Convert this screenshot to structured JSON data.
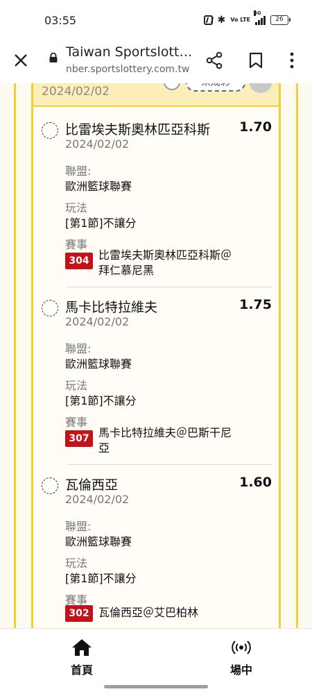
{
  "status_bar": {
    "time": "03:55",
    "signal_label": "5G",
    "volte_label": "Vo LTE",
    "battery": "26",
    "icons": [
      "nfc-icon",
      "bluetooth-icon",
      "volte-icon",
      "signal-icon",
      "battery-icon"
    ]
  },
  "app_bar": {
    "title": "Taiwan Sportslott…",
    "url": "nber.sportslottery.com.tw",
    "icons": [
      "close-icon",
      "lock-icon",
      "share-icon",
      "bookmark-icon",
      "more-vert-icon"
    ]
  },
  "panel_header": {
    "date": "2024/02/02",
    "pill_label": "未成彩"
  },
  "labels": {
    "league": "聯盟:",
    "bet_type": "玩法",
    "event": "賽事"
  },
  "bets": [
    {
      "team": "比雷埃夫斯奧林匹亞科斯",
      "odds": "1.70",
      "date": "2024/02/02",
      "league": "歐洲籃球聯賽",
      "bet_type": "[第1節]不讓分",
      "game_no": "304",
      "match": "比雷埃夫斯奧林匹亞科斯＠拜仁慕尼黑"
    },
    {
      "team": "馬卡比特拉維夫",
      "odds": "1.75",
      "date": "2024/02/02",
      "league": "歐洲籃球聯賽",
      "bet_type": "[第1節]不讓分",
      "game_no": "307",
      "match": "馬卡比特拉維夫＠巴斯干尼亞"
    },
    {
      "team": "瓦倫西亞",
      "odds": "1.60",
      "date": "2024/02/02",
      "league": "歐洲籃球聯賽",
      "bet_type": "[第1節]不讓分",
      "game_no": "302",
      "match": "瓦倫西亞＠艾巴柏林"
    }
  ],
  "bottom_nav": {
    "home_label": "首頁",
    "live_label": "場中",
    "icons": [
      "home-icon",
      "live-broadcast-icon"
    ]
  },
  "colors": {
    "frame_yellow": "#f4cf34",
    "header_bg": "#fbeeb8",
    "badge_red": "#c2121c"
  }
}
